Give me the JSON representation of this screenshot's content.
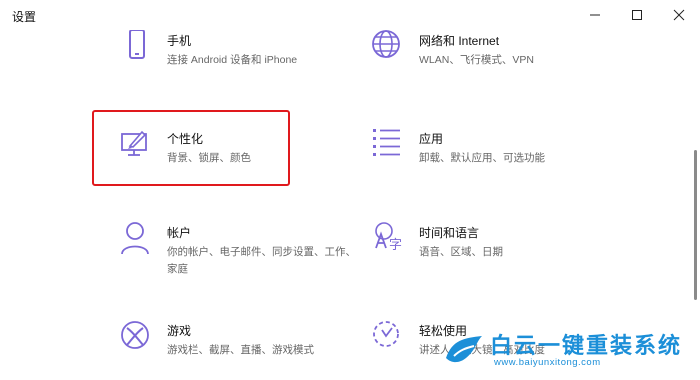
{
  "window": {
    "title": "设置"
  },
  "colors": {
    "accent": "#7b68d6",
    "highlight": "#e0191d",
    "watermark": "#1c8fd8"
  },
  "tiles": [
    {
      "name": "手机",
      "desc": "连接 Android 设备和 iPhone",
      "icon": "phone-icon"
    },
    {
      "name": "网络和 Internet",
      "desc": "WLAN、飞行模式、VPN",
      "icon": "globe-icon"
    },
    {
      "name": "个性化",
      "desc": "背景、锁屏、颜色",
      "icon": "personalization-icon"
    },
    {
      "name": "应用",
      "desc": "卸载、默认应用、可选功能",
      "icon": "apps-list-icon"
    },
    {
      "name": "帐户",
      "desc": "你的帐户、电子邮件、同步设置、工作、家庭",
      "icon": "account-icon"
    },
    {
      "name": "时间和语言",
      "desc": "语音、区域、日期",
      "icon": "time-language-icon"
    },
    {
      "name": "游戏",
      "desc": "游戏栏、截屏、直播、游戏模式",
      "icon": "xbox-icon"
    },
    {
      "name": "轻松使用",
      "desc": "讲述人、放大镜、高对比度",
      "icon": "ease-of-access-icon"
    }
  ],
  "watermark": {
    "text": "白云一键重装系统",
    "url": "www.baiyunxitong.com"
  }
}
